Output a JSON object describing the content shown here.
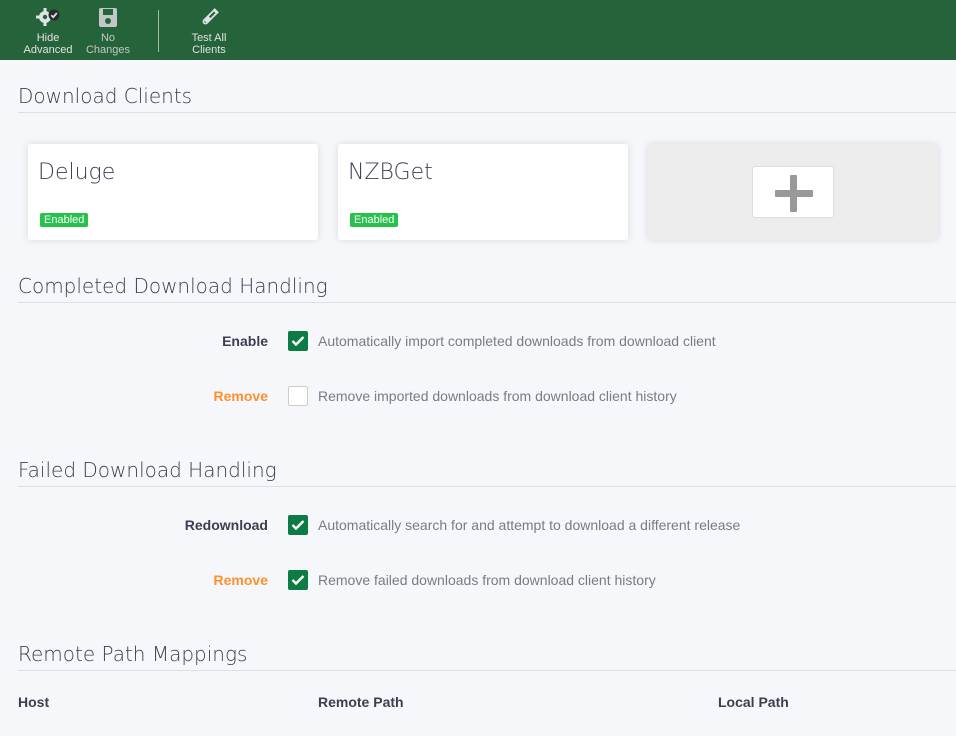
{
  "toolbar": {
    "buttons": [
      {
        "label_line1": "Hide",
        "label_line2": "Advanced",
        "icon": "gears-check-icon"
      },
      {
        "label_line1": "No",
        "label_line2": "Changes",
        "icon": "save-icon"
      },
      {
        "label_line1": "Test All",
        "label_line2": "Clients",
        "icon": "test-tube-icon"
      }
    ]
  },
  "download_clients": {
    "title": "Download Clients",
    "clients": [
      {
        "name": "Deluge",
        "status": "Enabled"
      },
      {
        "name": "NZBGet",
        "status": "Enabled"
      }
    ],
    "add_icon": "plus-icon"
  },
  "completed_handling": {
    "title": "Completed Download Handling",
    "fields": [
      {
        "label": "Enable",
        "help": "Automatically import completed downloads from download client",
        "checked": true,
        "label_style": "normal"
      },
      {
        "label": "Remove",
        "help": "Remove imported downloads from download client history",
        "checked": false,
        "label_style": "warning"
      }
    ]
  },
  "failed_handling": {
    "title": "Failed Download Handling",
    "fields": [
      {
        "label": "Redownload",
        "help": "Automatically search for and attempt to download a different release",
        "checked": true,
        "label_style": "normal"
      },
      {
        "label": "Remove",
        "help": "Remove failed downloads from download client history",
        "checked": true,
        "label_style": "warning"
      }
    ]
  },
  "remote_path_mappings": {
    "title": "Remote Path Mappings",
    "columns": [
      "Host",
      "Remote Path",
      "Local Path"
    ]
  },
  "colors": {
    "toolbar_bg": "#25633a",
    "checkbox_checked": "#0c7b44",
    "badge_enabled": "#27c24c",
    "warning_label": "#ff902b"
  }
}
